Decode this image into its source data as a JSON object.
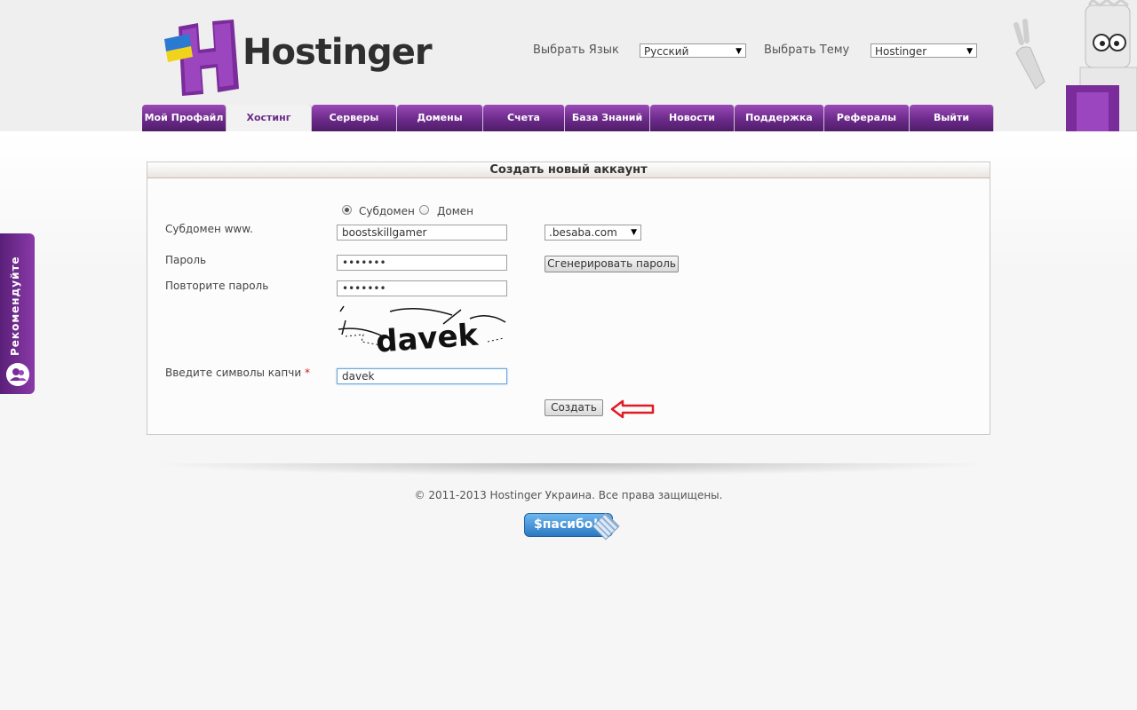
{
  "header": {
    "logo_text": "Hostinger",
    "language_label": "Выбрать Язык",
    "language_value": "Русский",
    "theme_label": "Выбрать Тему",
    "theme_value": "Hostinger"
  },
  "nav": {
    "items": [
      {
        "label": "Мой Профайл",
        "active": false
      },
      {
        "label": "Хостинг",
        "active": true
      },
      {
        "label": "Серверы",
        "active": false
      },
      {
        "label": "Домены",
        "active": false
      },
      {
        "label": "Счета",
        "active": false
      },
      {
        "label": "База Знаний",
        "active": false
      },
      {
        "label": "Новости",
        "active": false
      },
      {
        "label": "Поддержка",
        "active": false
      },
      {
        "label": "Рефералы",
        "active": false
      },
      {
        "label": "Выйти",
        "active": false
      }
    ]
  },
  "side_tab": {
    "label": "Рекомендуйте"
  },
  "form": {
    "title": "Создать новый аккаунт",
    "radio_subdomain": "Субдомен",
    "radio_domain": "Домен",
    "selected_type": "subdomain",
    "subdomain_label": "Субдомен www.",
    "subdomain_value": "boostskillgamer",
    "domain_suffix": ".besaba.com",
    "password_label": "Пароль",
    "password_value": "•••••••",
    "generate_button": "Сгенерировать пароль",
    "repeat_label": "Повторите пароль",
    "repeat_value": "•••••••",
    "captcha_image_text": "davek",
    "captcha_label": "Введите символы капчи",
    "required_mark": "*",
    "captcha_value": "davek",
    "submit_button": "Создать"
  },
  "footer": {
    "copyright": "© 2011-2013 Hostinger Украина. Все права защищены.",
    "thanks_button": "$пасибо!"
  },
  "colors": {
    "brand_purple": "#6c2a8a",
    "annotation_red": "#e01b24"
  }
}
